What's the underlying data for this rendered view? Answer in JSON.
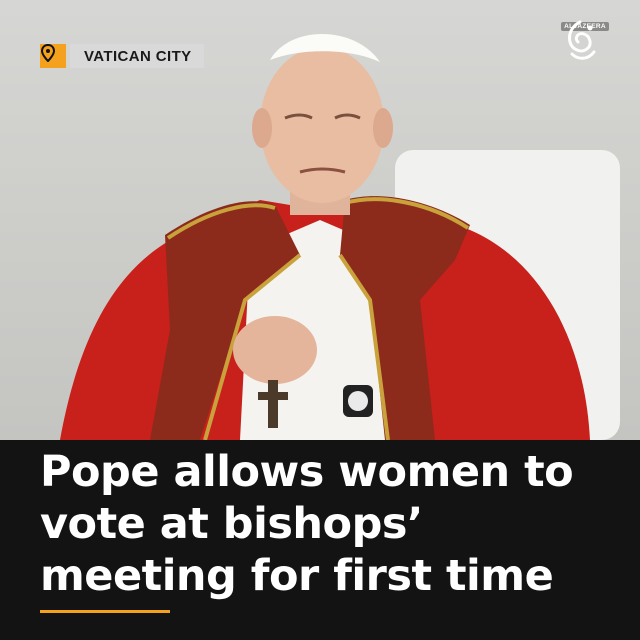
{
  "location": {
    "label": "VATICAN CITY",
    "icon": "map-pin-icon",
    "accent_color": "#f4a11d"
  },
  "logo": {
    "wordmark": "ALJAZEERA",
    "icon": "al-jazeera-logo-icon"
  },
  "headline": {
    "text": "Pope allows women to vote at bishops’ meeting for first time"
  },
  "colors": {
    "accent": "#f4a11d",
    "panel": "#131313",
    "vestment_red": "#c8201a",
    "stole": "#8c2a1c"
  }
}
